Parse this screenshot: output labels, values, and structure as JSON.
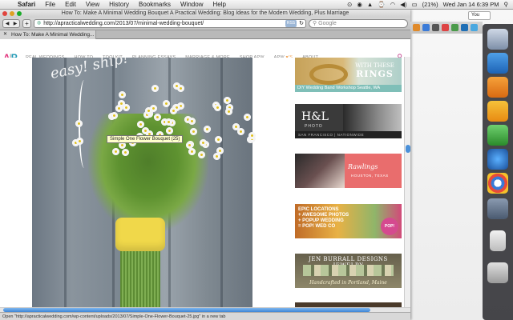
{
  "menubar": {
    "app": "Safari",
    "items": [
      "File",
      "Edit",
      "View",
      "History",
      "Bookmarks",
      "Window",
      "Help"
    ],
    "battery": "(21%)",
    "clock": "Wed Jan 14  6:39 PM"
  },
  "window": {
    "title": "How To: Make A Minimal Wedding Bouquet A Practical Wedding: Blog Ideas for the Modern Wedding, Plus Marriage",
    "url": "http://apracticalwedding.com/2013/07/minimal-wedding-bouquet/",
    "rss": "RSS",
    "search_placeholder": "Google",
    "tab_label": "How To: Make A Minimal Wedding..."
  },
  "site": {
    "logo_a": "A",
    "logo_p": "P",
    "logo_bar": "|",
    "nav": [
      "REAL WEDDINGS",
      "HOW TO",
      "TOOLKIT",
      "PLANNING ESSAYS",
      "MARRIAGE & MORE",
      "SHOP APW"
    ],
    "nav_apw": "APW",
    "nav_heart": "♥'S",
    "nav_about": "ABOUT"
  },
  "content": {
    "tooltip": "Simple One Flower Bouquet (25)",
    "photo_scribble": "easy! ship!"
  },
  "ads": {
    "ad1_with": "WITH",
    "ad1_these": "THESE",
    "ad1_rings": "RINGS",
    "ad1_strip": "DIY Wedding Band Workshop  Seattle, WA",
    "ad2_hl": "H&L",
    "ad2_photo": "PHOTO",
    "ad2_strip": "SAN FRANCISCO  |  NATIONWIDE",
    "ad3_title": "Rawlings",
    "ad3_sub": "HOUSTON, TEXAS",
    "ad4_text": "EPIC LOCATIONS\n+ AWESOME PHOTOS\n+ POPUP WEDDING\n= POP! WED CO",
    "ad4_badge": "POP!",
    "ad5_title": "JEN BURRALL DESIGNS JEWELRY",
    "ad5_sub": "Handcrafted in Portland, Maine"
  },
  "status": "Open \"http://apracticalwedding.com/wp-content/uploads/2013/07/Simple-One-Flower-Bouquet-25.jpg\" in a new tab",
  "right": {
    "you_label": "You"
  },
  "icons": [
    "apple-icon",
    "wifi-icon",
    "volume-icon",
    "battery-icon",
    "search-icon",
    "back-icon",
    "forward-icon",
    "plus-icon",
    "reload-icon",
    "rss-icon"
  ]
}
